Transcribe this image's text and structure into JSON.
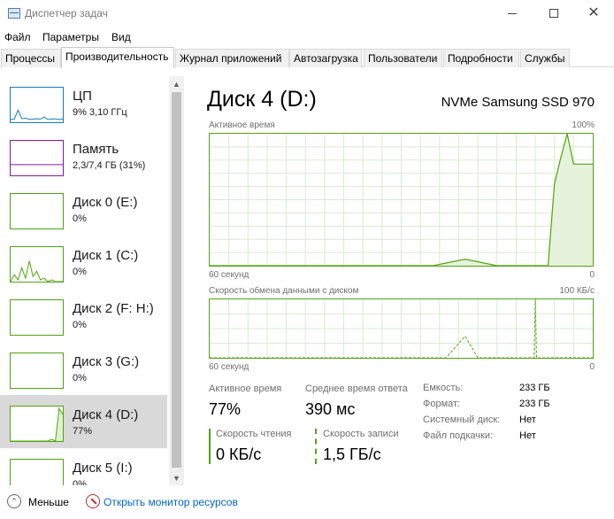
{
  "window": {
    "title": "Диспетчер задач"
  },
  "menu": {
    "items": [
      "Файл",
      "Параметры",
      "Вид"
    ]
  },
  "tabs": {
    "items": [
      "Процессы",
      "Производительность",
      "Журнал приложений",
      "Автозагрузка",
      "Пользователи",
      "Подробности",
      "Службы"
    ],
    "active": "Производительность"
  },
  "sidebar": {
    "items": [
      {
        "name": "ЦП",
        "value": "9%  3,10 ГГц",
        "color": "#117dbb"
      },
      {
        "name": "Память",
        "value": "2,3/7,4 ГБ (31%)",
        "color": "#8b12ae"
      },
      {
        "name": "Диск 0 (E:)",
        "value": "0%",
        "color": "#4da60c"
      },
      {
        "name": "Диск 1 (C:)",
        "value": "0%",
        "color": "#4da60c"
      },
      {
        "name": "Диск 2 (F: H:)",
        "value": "0%",
        "color": "#4da60c"
      },
      {
        "name": "Диск 3 (G:)",
        "value": "0%",
        "color": "#4da60c"
      },
      {
        "name": "Диск 4 (D:)",
        "value": "77%",
        "color": "#4da60c"
      },
      {
        "name": "Диск 5 (I:)",
        "value": "0%",
        "color": "#4da60c"
      }
    ],
    "selected": "Диск 4 (D:)"
  },
  "main": {
    "title": "Диск 4 (D:)",
    "device": "NVMe Samsung SSD 970",
    "active_graph": {
      "label": "Активное время",
      "max_label": "100%",
      "time_label": "60 секунд",
      "min_label": "0"
    },
    "transfer_graph": {
      "label": "Скорость обмена данными с диском",
      "max_label": "100 КБ/с",
      "time_label": "60 секунд",
      "min_label": "0"
    },
    "stats": {
      "active_time_label": "Активное время",
      "active_time_value": "77%",
      "avg_response_label": "Среднее время ответа",
      "avg_response_value": "390 мс",
      "read_label": "Скорость чтения",
      "read_value": "0 КБ/с",
      "write_label": "Скорость записи",
      "write_value": "1,5 ГБ/с"
    },
    "properties": [
      {
        "label": "Емкость:",
        "value": "233 ГБ"
      },
      {
        "label": "Формат:",
        "value": "233 ГБ"
      },
      {
        "label": "Системный диск:",
        "value": "Нет"
      },
      {
        "label": "Файл подкачки:",
        "value": "Нет"
      }
    ]
  },
  "footer": {
    "fewer_label": "Меньше",
    "monitor_label": "Открыть монитор ресурсов"
  },
  "chart_data": [
    {
      "type": "area",
      "title": "Активное время",
      "x": [
        60,
        55,
        50,
        45,
        40,
        35,
        30,
        25,
        20,
        15,
        10,
        9,
        7,
        6,
        5,
        4,
        3,
        2,
        1,
        0
      ],
      "series": [
        {
          "values": [
            0,
            0,
            0,
            0,
            0,
            0,
            0,
            0,
            5,
            0,
            0,
            0,
            0,
            62,
            82,
            100,
            77,
            77,
            77,
            77
          ]
        }
      ],
      "ylim": [
        0,
        100
      ],
      "xlim": [
        60,
        0
      ]
    },
    {
      "type": "line",
      "title": "Скорость обмена данными с диском",
      "x": [
        60,
        30,
        25,
        23,
        20,
        18,
        10,
        9.2,
        9,
        8.8,
        0
      ],
      "series": [
        {
          "values": [
            0,
            0,
            0,
            0,
            37,
            0,
            0,
            0,
            100,
            0,
            0
          ]
        }
      ],
      "ylim": [
        0,
        100
      ],
      "xlim": [
        60,
        0
      ]
    }
  ],
  "thumbs": {
    "cpu": [
      8,
      9,
      35,
      10,
      12,
      8,
      9,
      10,
      9,
      15,
      8,
      9,
      10,
      8,
      9
    ],
    "memory": [
      31,
      31,
      31,
      31,
      31,
      31,
      31,
      31,
      31,
      31,
      31,
      31,
      31,
      31,
      31
    ],
    "disk1": [
      0,
      20,
      5,
      40,
      10,
      60,
      15,
      30,
      5,
      10,
      0,
      5,
      0,
      0,
      0
    ],
    "disk4": [
      0,
      0,
      0,
      0,
      0,
      0,
      0,
      0,
      0,
      0,
      0,
      5,
      0,
      95,
      77
    ]
  }
}
